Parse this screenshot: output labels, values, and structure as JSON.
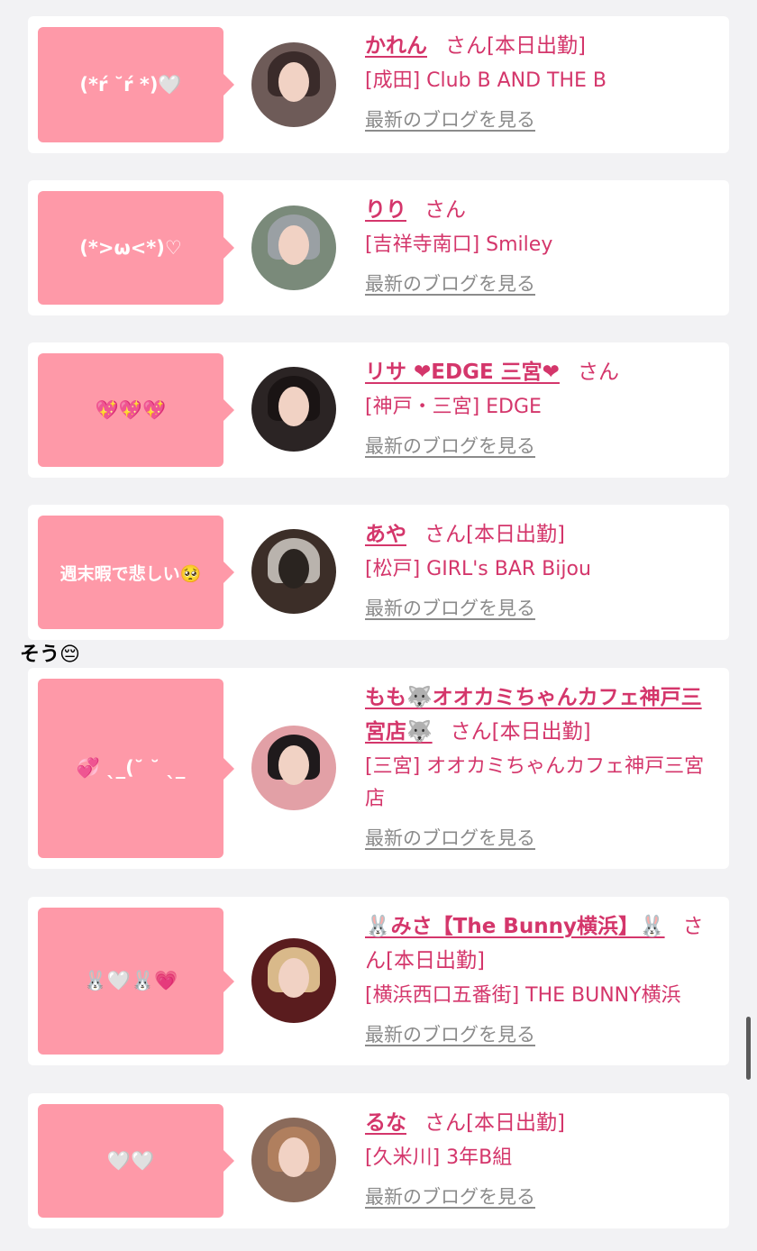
{
  "entries": [
    {
      "bubble": "(*ŕ ˘ŕ *)🤍",
      "name": "かれん",
      "san": "さん",
      "status": "[本日出勤]",
      "location": "[成田] Club B AND THE B",
      "blog": "最新のブログを見る"
    },
    {
      "bubble": "(*>ω<*)♡",
      "name": "りり",
      "san": "さん",
      "status": "",
      "location": "[吉祥寺南口] Smiley",
      "blog": "最新のブログを見る"
    },
    {
      "bubble": "💖💖💖",
      "name": "リサ ❤EDGE 三宮❤",
      "san": "さん",
      "status": "",
      "location": "[神戸・三宮] EDGE",
      "blog": "最新のブログを見る"
    },
    {
      "bubble": "週末暇で悲しい🥺",
      "name": "あや",
      "san": "さん",
      "status": "[本日出勤]",
      "location": "[松戸] GIRL's BAR Bijou",
      "blog": "最新のブログを見る"
    },
    {
      "bubble": "💞 ˎ_(˘ ˘ ˎ_",
      "name": "もも🐺オオカミちゃんカフェ神戸三宮店🐺",
      "san": "さん",
      "status": "[本日出勤]",
      "location": "[三宮] オオカミちゃんカフェ神戸三宮店",
      "blog": "最新のブログを見る"
    },
    {
      "bubble": "🐰🤍🐰💗",
      "name": "🐰みさ【The Bunny横浜】🐰",
      "san": "さん",
      "status": "[本日出勤]",
      "location": "[横浜西口五番街] THE BUNNY横浜",
      "blog": "最新のブログを見る"
    },
    {
      "bubble": "🤍🤍",
      "name": "るな",
      "san": "さん",
      "status": "[本日出勤]",
      "location": "[久米川] 3年B組",
      "blog": "最新のブログを見る"
    }
  ],
  "floating_text": "そう😔",
  "colors": {
    "accent": "#d4366b",
    "bubble": "#fe99a8",
    "link_gray": "#8b8b8b"
  }
}
